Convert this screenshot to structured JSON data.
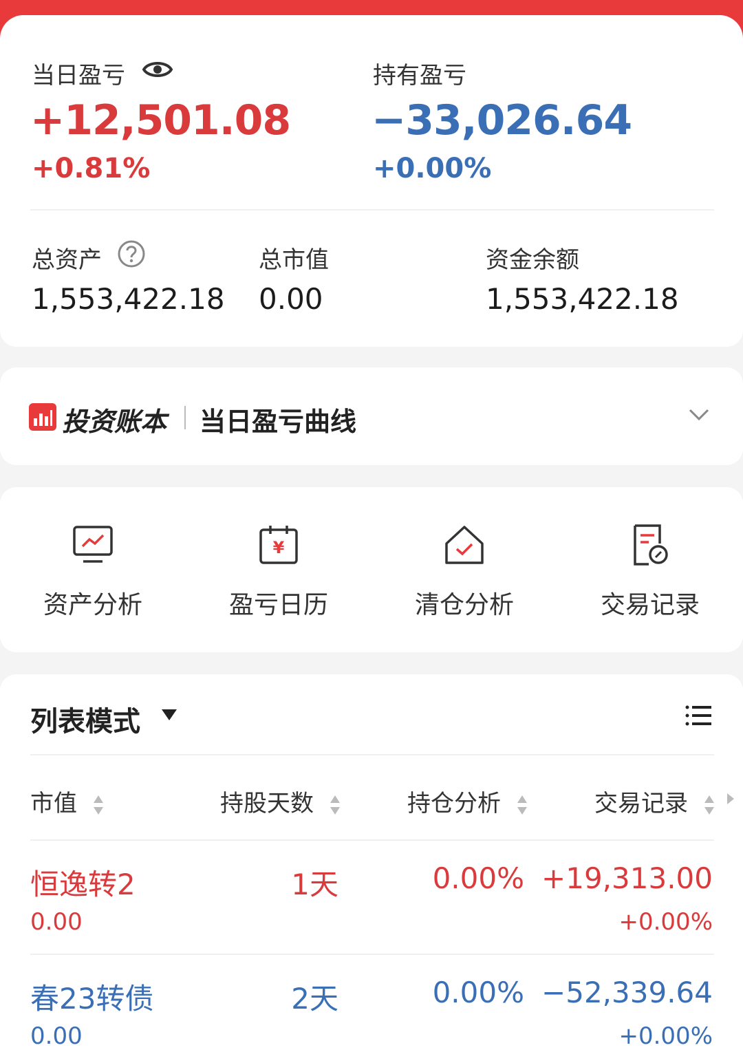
{
  "colors": {
    "up": "#d93a3c",
    "down": "#3a6fb5",
    "brand": "#e8393b"
  },
  "summary": {
    "daily_pnl_label": "当日盈亏",
    "daily_pnl_value": "+12,501.08",
    "daily_pnl_pct": "+0.81%",
    "holding_pnl_label": "持有盈亏",
    "holding_pnl_value": "−33,026.64",
    "holding_pnl_pct": "+0.00%",
    "total_assets_label": "总资产",
    "total_assets_value": "1,553,422.18",
    "market_value_label": "总市值",
    "market_value_value": "0.00",
    "cash_balance_label": "资金余额",
    "cash_balance_value": "1,553,422.18",
    "icons": {
      "visibility": "eye-icon",
      "help": "question-circle-icon"
    }
  },
  "chart_entry": {
    "brand_name": "投资账本",
    "title": "当日盈亏曲线",
    "icons": {
      "logo": "ledger-logo-icon",
      "expand": "chevron-down-icon"
    }
  },
  "tools": [
    {
      "label": "资产分析",
      "icon": "chart-monitor-icon"
    },
    {
      "label": "盈亏日历",
      "icon": "calendar-yuan-icon"
    },
    {
      "label": "清仓分析",
      "icon": "house-check-icon"
    },
    {
      "label": "交易记录",
      "icon": "document-clock-icon"
    }
  ],
  "holdings": {
    "mode_label": "列表模式",
    "icons": {
      "mode": "triangle-down-icon",
      "menu": "list-menu-icon"
    },
    "columns": [
      "市值",
      "持股天数",
      "持仓分析",
      "交易记录"
    ],
    "rows": [
      {
        "name": "恒逸转2",
        "market_value": "0.00",
        "days": "1天",
        "position_pct": "0.00%",
        "pnl": "+19,313.00",
        "pnl_pct": "+0.00%",
        "trend": "up"
      },
      {
        "name": "春23转债",
        "market_value": "0.00",
        "days": "2天",
        "position_pct": "0.00%",
        "pnl": "−52,339.64",
        "pnl_pct": "+0.00%",
        "trend": "down"
      }
    ]
  }
}
